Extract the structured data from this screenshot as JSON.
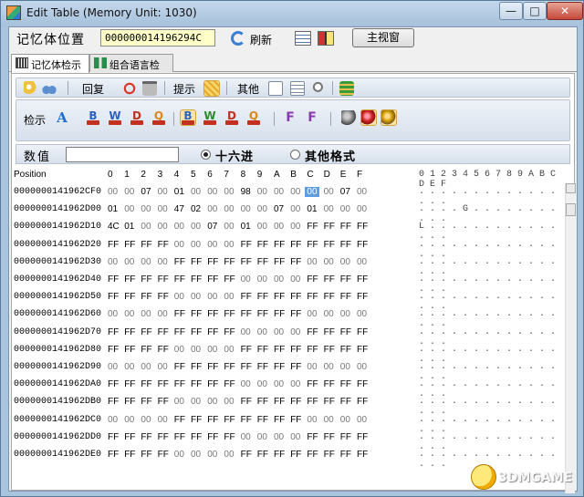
{
  "window": {
    "title": "Edit Table (Memory Unit: 1030)",
    "minimize": "—",
    "maximize": "□",
    "close": "✕"
  },
  "addrbar": {
    "label": "记忆体位置",
    "address": "000000014196294C",
    "refresh": "刷新",
    "main_window": "主视窗"
  },
  "tabs": [
    {
      "label": "记忆体检示",
      "icon": "hexview-icon"
    },
    {
      "label": "组合语言检示",
      "icon": "assembly-icon"
    }
  ],
  "toolbar1": {
    "undo_label": "回复",
    "hint_label": "提示",
    "other_label": "其他"
  },
  "toolbar2": {
    "view_label": "检示",
    "ctl_labels": [
      "DEF",
      "DEC",
      "DEC",
      "DEF",
      "HEX",
      "HEX",
      "HEX",
      "HEX"
    ],
    "font_letter": "A"
  },
  "format": {
    "value_label": "数值",
    "value": "",
    "hex_label": "十六进",
    "other_label": "其他格式",
    "selected": "hex"
  },
  "hex": {
    "position_label": "Position",
    "columns": [
      "0",
      "1",
      "2",
      "3",
      "4",
      "5",
      "6",
      "7",
      "8",
      "9",
      "A",
      "B",
      "C",
      "D",
      "E",
      "F"
    ],
    "ascii_header": "0 1 2 3 4 5 6 7 8 9 A B C D E F",
    "selected": {
      "row": 0,
      "col": 12
    },
    "rows": [
      {
        "addr": "0000000141962CF0",
        "bytes": [
          "00",
          "00",
          "07",
          "00",
          "01",
          "00",
          "00",
          "00",
          "98",
          "00",
          "00",
          "00",
          "00",
          "00",
          "07",
          "00"
        ],
        "ascii": ". . . . . . . . . . . . . . . ."
      },
      {
        "addr": "0000000141962D00",
        "bytes": [
          "01",
          "00",
          "00",
          "00",
          "47",
          "02",
          "00",
          "00",
          "00",
          "00",
          "07",
          "00",
          "01",
          "00",
          "00",
          "00"
        ],
        "ascii": ". . . . G . . . . . . . . . . ."
      },
      {
        "addr": "0000000141962D10",
        "bytes": [
          "4C",
          "01",
          "00",
          "00",
          "00",
          "00",
          "07",
          "00",
          "01",
          "00",
          "00",
          "00",
          "FF",
          "FF",
          "FF",
          "FF"
        ],
        "ascii": "L . . . . . . . . . . . . . . ."
      },
      {
        "addr": "0000000141962D20",
        "bytes": [
          "FF",
          "FF",
          "FF",
          "FF",
          "00",
          "00",
          "00",
          "00",
          "FF",
          "FF",
          "FF",
          "FF",
          "FF",
          "FF",
          "FF",
          "FF"
        ],
        "ascii": ". . . . . . . . . . . . . . . ."
      },
      {
        "addr": "0000000141962D30",
        "bytes": [
          "00",
          "00",
          "00",
          "00",
          "FF",
          "FF",
          "FF",
          "FF",
          "FF",
          "FF",
          "FF",
          "FF",
          "00",
          "00",
          "00",
          "00"
        ],
        "ascii": ". . . . . . . . . . . . . . . ."
      },
      {
        "addr": "0000000141962D40",
        "bytes": [
          "FF",
          "FF",
          "FF",
          "FF",
          "FF",
          "FF",
          "FF",
          "FF",
          "00",
          "00",
          "00",
          "00",
          "FF",
          "FF",
          "FF",
          "FF"
        ],
        "ascii": ". . . . . . . . . . . . . . . ."
      },
      {
        "addr": "0000000141962D50",
        "bytes": [
          "FF",
          "FF",
          "FF",
          "FF",
          "00",
          "00",
          "00",
          "00",
          "FF",
          "FF",
          "FF",
          "FF",
          "FF",
          "FF",
          "FF",
          "FF"
        ],
        "ascii": ". . . . . . . . . . . . . . . ."
      },
      {
        "addr": "0000000141962D60",
        "bytes": [
          "00",
          "00",
          "00",
          "00",
          "FF",
          "FF",
          "FF",
          "FF",
          "FF",
          "FF",
          "FF",
          "FF",
          "00",
          "00",
          "00",
          "00"
        ],
        "ascii": ". . . . . . . . . . . . . . . ."
      },
      {
        "addr": "0000000141962D70",
        "bytes": [
          "FF",
          "FF",
          "FF",
          "FF",
          "FF",
          "FF",
          "FF",
          "FF",
          "00",
          "00",
          "00",
          "00",
          "FF",
          "FF",
          "FF",
          "FF"
        ],
        "ascii": ". . . . . . . . . . . . . . . ."
      },
      {
        "addr": "0000000141962D80",
        "bytes": [
          "FF",
          "FF",
          "FF",
          "FF",
          "00",
          "00",
          "00",
          "00",
          "FF",
          "FF",
          "FF",
          "FF",
          "FF",
          "FF",
          "FF",
          "FF"
        ],
        "ascii": ". . . . . . . . . . . . . . . ."
      },
      {
        "addr": "0000000141962D90",
        "bytes": [
          "00",
          "00",
          "00",
          "00",
          "FF",
          "FF",
          "FF",
          "FF",
          "FF",
          "FF",
          "FF",
          "FF",
          "00",
          "00",
          "00",
          "00"
        ],
        "ascii": ". . . . . . . . . . . . . . . ."
      },
      {
        "addr": "0000000141962DA0",
        "bytes": [
          "FF",
          "FF",
          "FF",
          "FF",
          "FF",
          "FF",
          "FF",
          "FF",
          "00",
          "00",
          "00",
          "00",
          "FF",
          "FF",
          "FF",
          "FF"
        ],
        "ascii": ". . . . . . . . . . . . . . . ."
      },
      {
        "addr": "0000000141962DB0",
        "bytes": [
          "FF",
          "FF",
          "FF",
          "FF",
          "00",
          "00",
          "00",
          "00",
          "FF",
          "FF",
          "FF",
          "FF",
          "FF",
          "FF",
          "FF",
          "FF"
        ],
        "ascii": ". . . . . . . . . . . . . . . ."
      },
      {
        "addr": "0000000141962DC0",
        "bytes": [
          "00",
          "00",
          "00",
          "00",
          "FF",
          "FF",
          "FF",
          "FF",
          "FF",
          "FF",
          "FF",
          "FF",
          "00",
          "00",
          "00",
          "00"
        ],
        "ascii": ". . . . . . . . . . . . . . . ."
      },
      {
        "addr": "0000000141962DD0",
        "bytes": [
          "FF",
          "FF",
          "FF",
          "FF",
          "FF",
          "FF",
          "FF",
          "FF",
          "00",
          "00",
          "00",
          "00",
          "FF",
          "FF",
          "FF",
          "FF"
        ],
        "ascii": ". . . . . . . . . . . . . . . ."
      },
      {
        "addr": "0000000141962DE0",
        "bytes": [
          "FF",
          "FF",
          "FF",
          "FF",
          "00",
          "00",
          "00",
          "00",
          "FF",
          "FF",
          "FF",
          "FF",
          "FF",
          "FF",
          "FF",
          "FF"
        ],
        "ascii": ". . . . . . . . . . . . . . . ."
      }
    ]
  },
  "watermark": {
    "text": "3DMGAME"
  }
}
